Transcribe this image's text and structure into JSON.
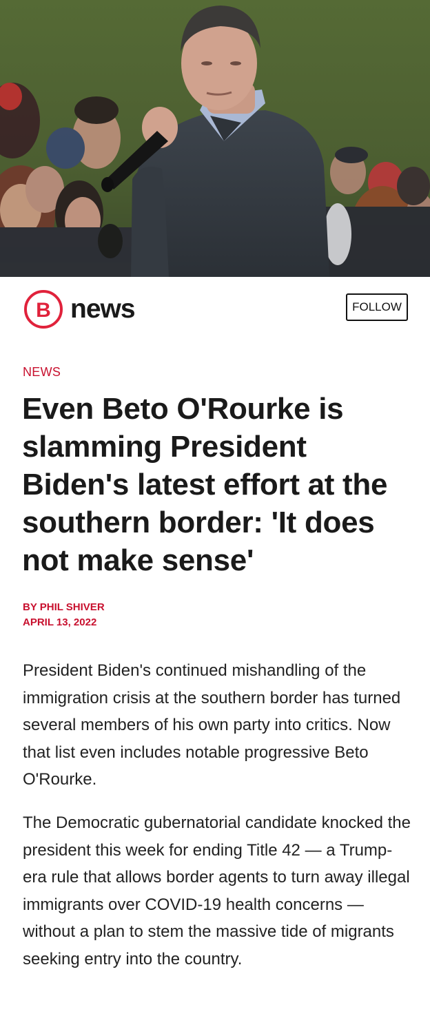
{
  "hero": {
    "image_name": "speaker-with-microphone-photo"
  },
  "publisher": {
    "logo_letter": "B",
    "name": "news",
    "brand_color": "#c8102e",
    "follow_label": "FOLLOW"
  },
  "article": {
    "category": "NEWS",
    "headline": "Even Beto O'Rourke is slamming President Biden's latest effort at the southern border: 'It does not make sense'",
    "byline": "BY PHIL SHIVER",
    "date": "APRIL 13, 2022",
    "paragraphs": [
      "President Biden's continued mishandling of the immigration crisis at the southern border has turned several members of his own party into critics. Now that list even includes notable progressive Beto O'Rourke.",
      "The Democratic gubernatorial candidate knocked the president this week for ending Title 42 — a Trump-era rule that allows border agents to turn away illegal immigrants over COVID-19 health concerns — without a plan to stem the massive tide of migrants seeking entry into the country."
    ]
  }
}
